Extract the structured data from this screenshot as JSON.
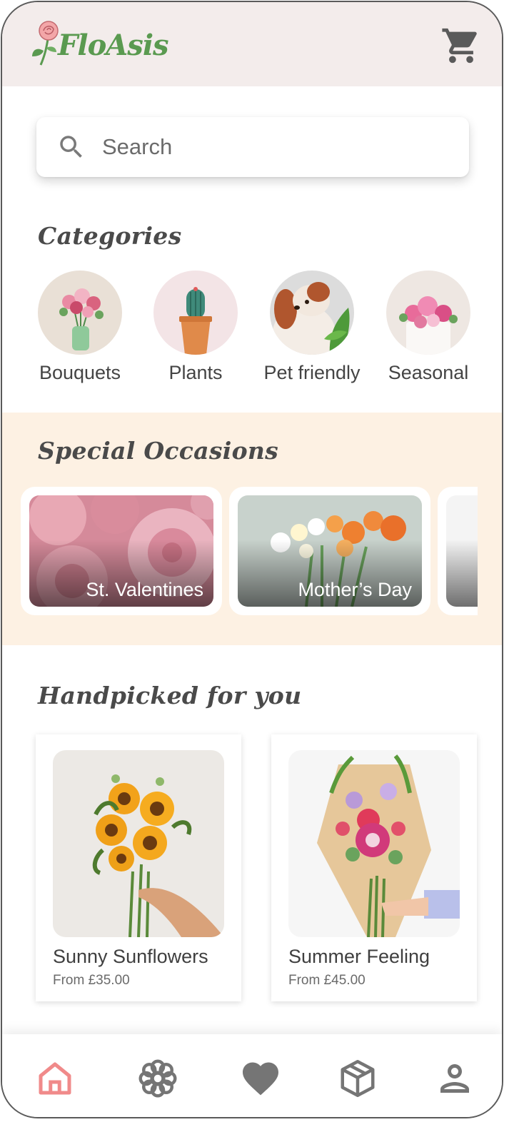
{
  "app": {
    "brand": "FloAsis"
  },
  "header": {
    "cart_icon": "shopping-cart-icon"
  },
  "search": {
    "placeholder": "Search",
    "icon": "search-icon"
  },
  "categories": {
    "title": "Categories",
    "items": [
      {
        "label": "Bouquets"
      },
      {
        "label": "Plants"
      },
      {
        "label": "Pet friendly"
      },
      {
        "label": "Seasonal"
      }
    ]
  },
  "occasions": {
    "title": "Special Occasions",
    "items": [
      {
        "label": "St. Valentines"
      },
      {
        "label": "Mother’s Day"
      }
    ]
  },
  "handpicked": {
    "title": "Handpicked for you",
    "products": [
      {
        "name": "Sunny Sunflowers",
        "price": "From £35.00"
      },
      {
        "name": "Summer Feeling",
        "price": "From £45.00"
      }
    ]
  },
  "nav": {
    "items": [
      {
        "icon": "home-icon",
        "active": true
      },
      {
        "icon": "flower-icon",
        "active": false
      },
      {
        "icon": "heart-icon",
        "active": false
      },
      {
        "icon": "package-icon",
        "active": false
      },
      {
        "icon": "profile-icon",
        "active": false
      }
    ],
    "active_color": "#f08a8a",
    "inactive_color": "#757575"
  },
  "colors": {
    "brand_green": "#5a9a50",
    "header_bg": "#f3eceb",
    "occasions_bg": "#fdf1e3"
  }
}
